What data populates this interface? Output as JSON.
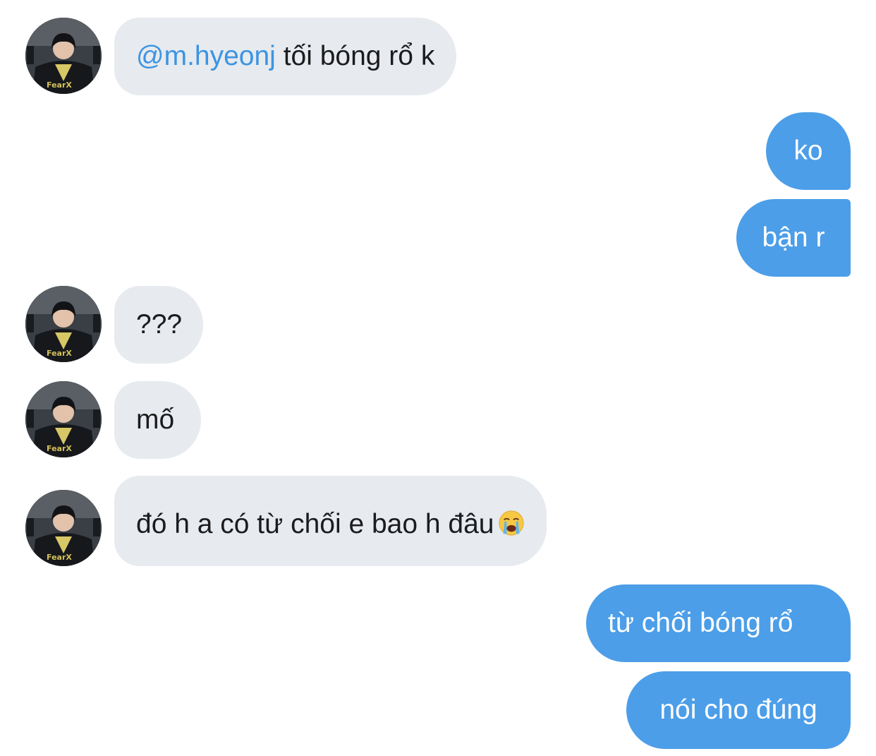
{
  "conversation": {
    "messages": [
      {
        "direction": "in",
        "mention": "@m.hyeonj",
        "text": "tối bóng rổ k",
        "avatar_text": "FearX"
      },
      {
        "direction": "out",
        "text": "ko"
      },
      {
        "direction": "out",
        "text": "bận r"
      },
      {
        "direction": "in",
        "text": "???",
        "avatar_text": "FearX"
      },
      {
        "direction": "in",
        "text": "mố",
        "avatar_text": "FearX"
      },
      {
        "direction": "in",
        "text": "đó h a có từ chối e bao h đâu",
        "emoji": "loudly-crying-face",
        "avatar_text": "FearX"
      },
      {
        "direction": "out",
        "text": "từ chối bóng rổ"
      },
      {
        "direction": "out",
        "text": "nói cho đúng"
      }
    ]
  },
  "colors": {
    "incoming_bubble": "#e7eaee",
    "outgoing_bubble": "#4c9ee8",
    "mention": "#3b94e3",
    "background": "#ffffff"
  }
}
